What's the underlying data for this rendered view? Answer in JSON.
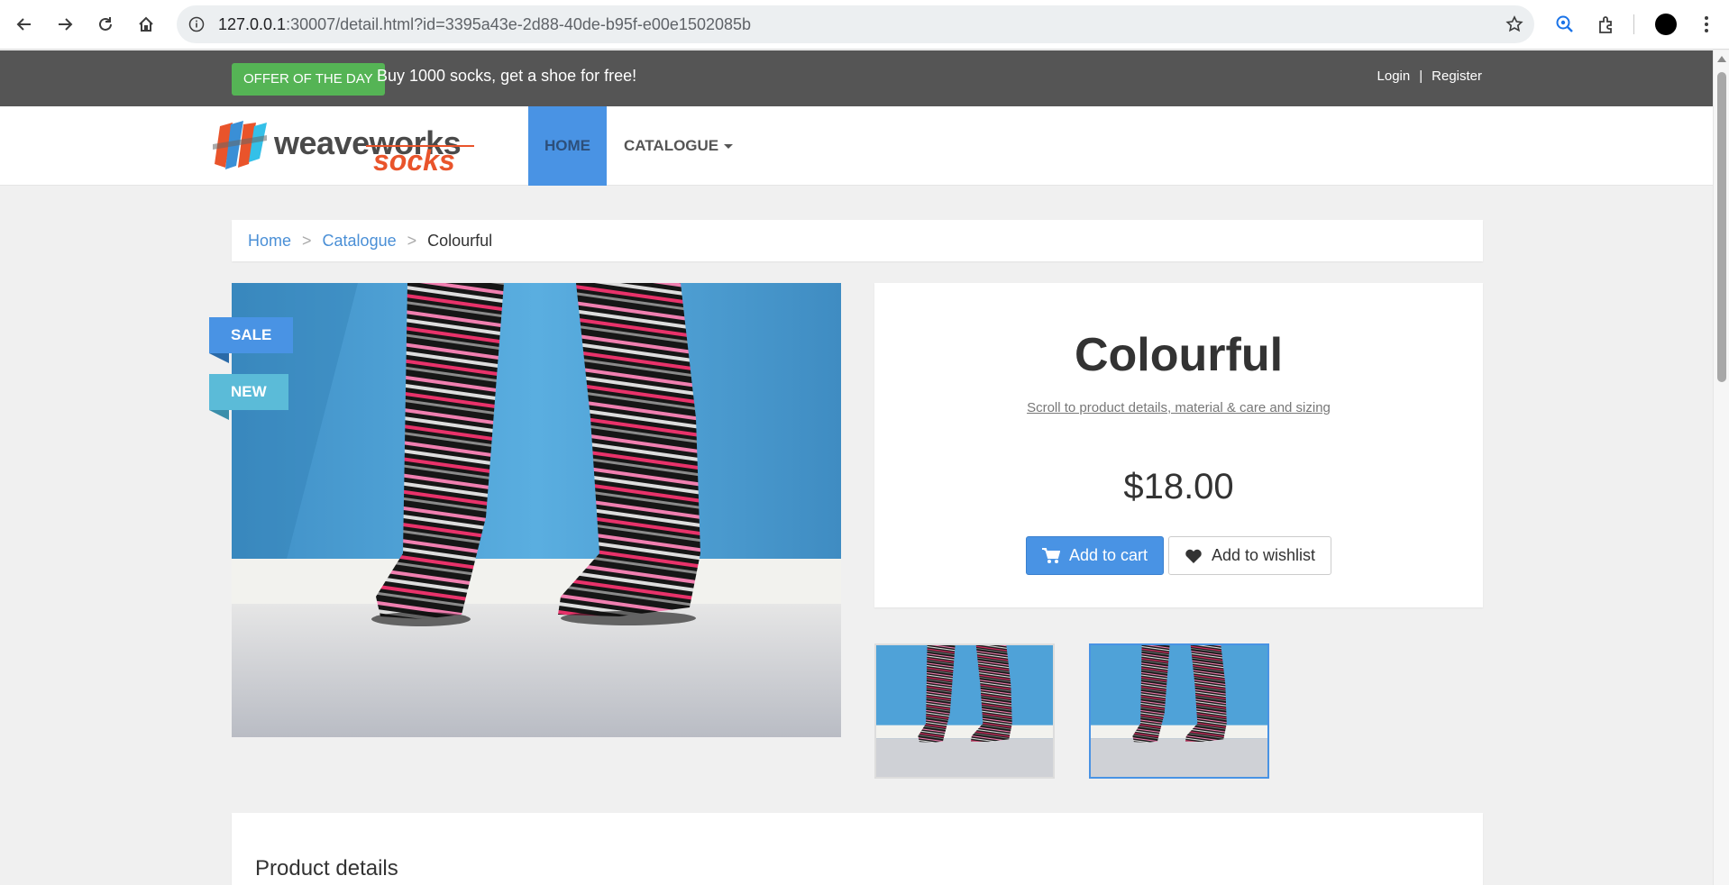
{
  "browser": {
    "url_host": "127.0.0.1",
    "url_rest": ":30007/detail.html?id=3395a43e-2d88-40de-b95f-e00e1502085b"
  },
  "offer": {
    "badge": "OFFER OF THE DAY",
    "text": "Buy 1000 socks, get a shoe for free!"
  },
  "auth": {
    "login": "Login",
    "separator": "|",
    "register": "Register"
  },
  "logo": {
    "weave": "weave",
    "works": "works",
    "socks": "socks"
  },
  "nav": {
    "home": "HOME",
    "catalogue": "CATALOGUE"
  },
  "breadcrumb": {
    "home": "Home",
    "catalogue": "Catalogue",
    "current": "Colourful",
    "separator": ">"
  },
  "product": {
    "name": "Colourful",
    "scroll_link": "Scroll to product details, material & care and sizing",
    "price": "$18.00",
    "add_to_cart": "Add to cart",
    "add_to_wishlist": "Add to wishlist",
    "ribbons": {
      "sale": "SALE",
      "new": "NEW"
    }
  },
  "details": {
    "title": "Product details"
  },
  "colors": {
    "accent": "#4993e4",
    "offer_green": "#55b455",
    "topbar": "#555555",
    "brand_orange": "#e9542b"
  }
}
